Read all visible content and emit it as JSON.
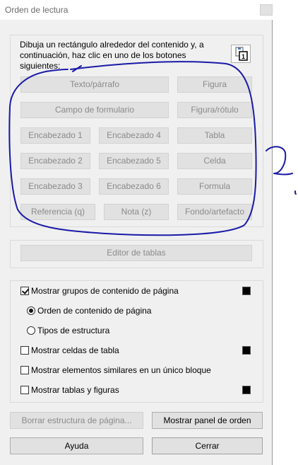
{
  "window": {
    "title": "Orden de lectura"
  },
  "instructions": "Dibuja un rectángulo alrededor del contenido y, a continuación, haz clic en uno de los botones siguientes:",
  "tag_buttons": {
    "text_paragraph": "Texto/párrafo",
    "figure": "Figura",
    "form_field": "Campo de formulario",
    "figure_caption": "Figura/rótulo",
    "heading1": "Encabezado 1",
    "heading4": "Encabezado 4",
    "table": "Tabla",
    "heading2": "Encabezado 2",
    "heading5": "Encabezado 5",
    "cell": "Celda",
    "heading3": "Encabezado 3",
    "heading6": "Encabezado 6",
    "formula": "Formula",
    "reference": "Referencia (q)",
    "note": "Nota (z)",
    "background": "Fondo/artefacto"
  },
  "table_editor": {
    "label": "Editor de tablas"
  },
  "options": {
    "show_page_content_groups": {
      "label": "Mostrar grupos de contenido de página",
      "checked": true
    },
    "page_content_order": {
      "label": "Orden de contenido de página",
      "selected": true
    },
    "structure_types": {
      "label": "Tipos de estructura",
      "selected": false
    },
    "show_table_cells": {
      "label": "Mostrar celdas de tabla",
      "checked": false
    },
    "show_similar_single_block": {
      "label": "Mostrar elementos similares en un único bloque",
      "checked": false
    },
    "show_tables_figures": {
      "label": "Mostrar tablas y figuras",
      "checked": false
    }
  },
  "footer": {
    "clear_structure": "Borrar estructura de página...",
    "show_order_panel": "Mostrar panel de orden",
    "help": "Ayuda",
    "close": "Cerrar"
  },
  "colors": {
    "swatch": "#000000",
    "annotation_ink": "#1a1aa8"
  }
}
